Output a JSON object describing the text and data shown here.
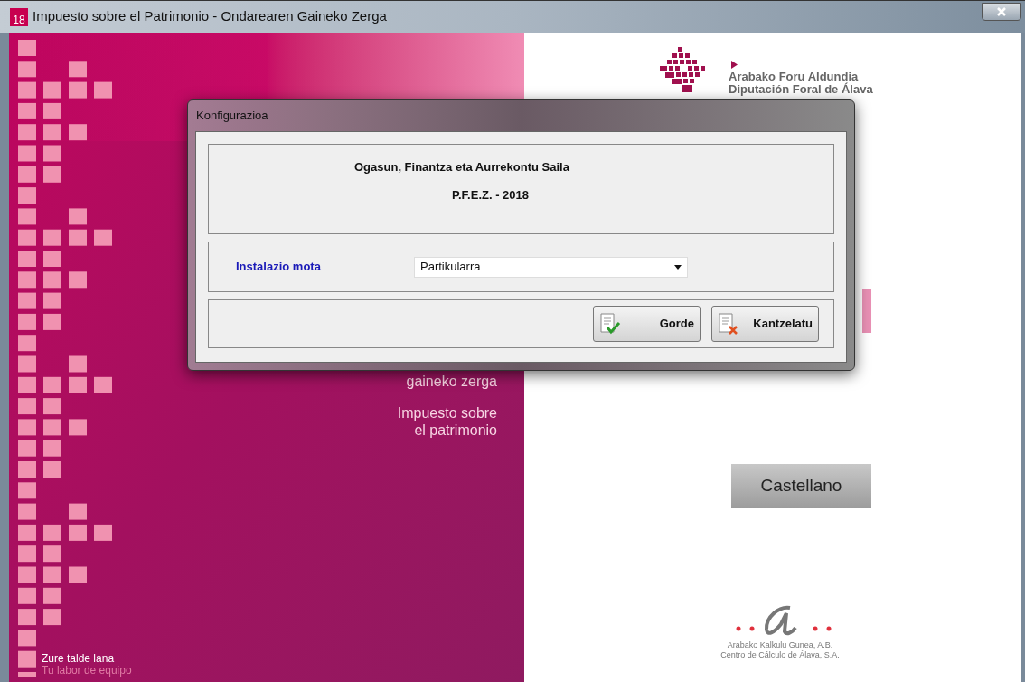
{
  "window": {
    "title": "Impuesto sobre el Patrimonio - Ondarearen Gaineko Zerga",
    "app_icon_number": "18"
  },
  "splash": {
    "tax_lines": [
      {
        "lines": [
          "gaineko zerga"
        ]
      },
      {
        "lines": [
          "Impuesto sobre",
          "el patrimonio"
        ]
      }
    ],
    "footer": [
      "Zure talde lana",
      "Tu labor de equipo"
    ],
    "org_logo": [
      "Arabako Foru Aldundia",
      "Diputación Foral de Álava"
    ],
    "language_button": "Castellano",
    "company_logo": [
      "Arabako Kalkulu Gunea, A.B.",
      "Centro de Cálculo de Álava, S.A."
    ]
  },
  "dialog": {
    "title": "Konfigurazioa",
    "header": [
      "Ogasun, Finantza eta Aurrekontu Saila",
      "P.F.E.Z. - 2018"
    ],
    "field": {
      "label": "Instalazio mota",
      "value": "Partikularra"
    },
    "buttons": [
      {
        "kind": "save",
        "label": "Gorde"
      },
      {
        "kind": "cancel",
        "label": "Kantzelatu"
      }
    ]
  }
}
